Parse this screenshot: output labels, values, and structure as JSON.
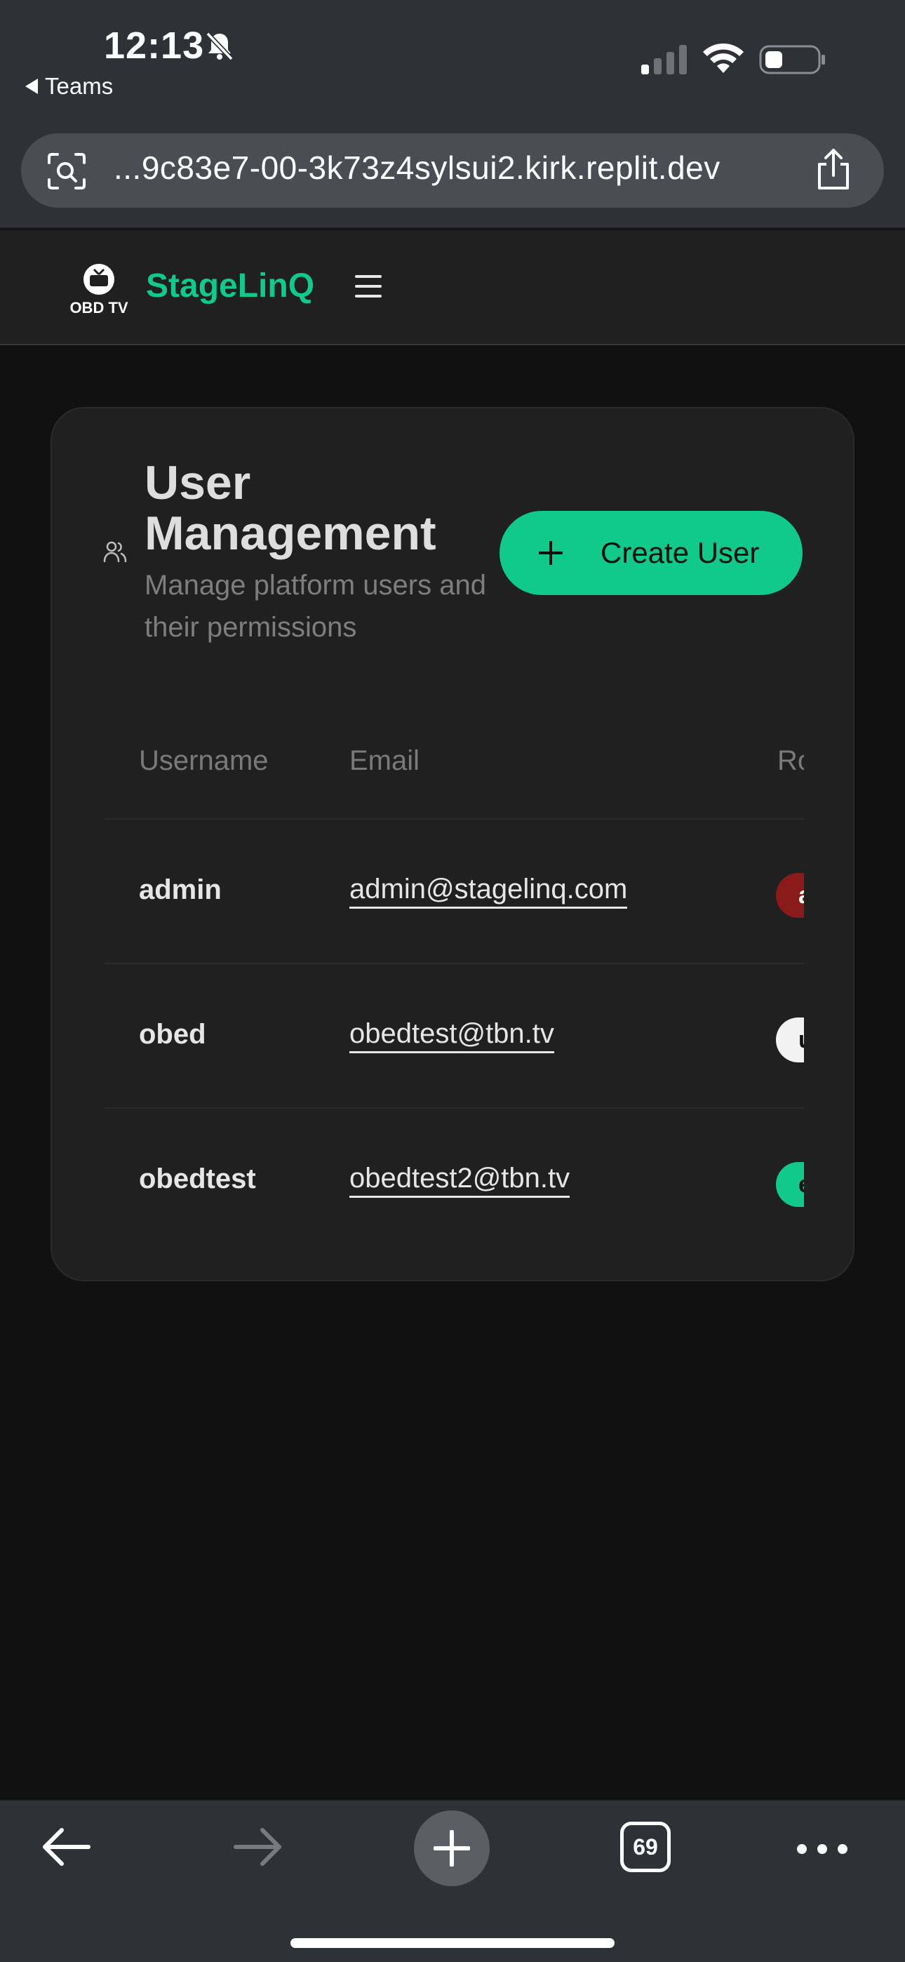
{
  "status_bar": {
    "time": "12:13",
    "back_app": "Teams"
  },
  "browser": {
    "url": "...9c83e7-00-3k73z4sylsui2.kirk.replit.dev",
    "tab_count": "69"
  },
  "app": {
    "brand": "StageLinQ",
    "logo_text": "OBD TV",
    "brand_color": "#10c98a"
  },
  "page": {
    "title": "User Management",
    "subtitle": "Manage platform users and their permissions",
    "create_button": "Create User"
  },
  "table": {
    "headers": [
      "Username",
      "Email",
      "Role"
    ],
    "rows": [
      {
        "username": "admin",
        "email": "admin@stagelinq.com",
        "role": "admin",
        "role_color": "#8b1a1a",
        "role_text_color": "#ffffff"
      },
      {
        "username": "obed",
        "email": "obedtest@tbn.tv",
        "role": "user",
        "role_color": "#f2f2f2",
        "role_text_color": "#111111"
      },
      {
        "username": "obedtest",
        "email": "obedtest2@tbn.tv",
        "role": "engineer",
        "role_color": "#10c98a",
        "role_text_color": "#111111"
      }
    ]
  },
  "icons": {
    "status": [
      "bell-slash-icon",
      "cellular-signal-icon",
      "wifi-icon",
      "battery-icon"
    ],
    "browser": [
      "visual-lookup-icon",
      "share-icon",
      "back-arrow-icon",
      "forward-arrow-icon",
      "new-tab-icon",
      "tabs-icon",
      "more-icon"
    ],
    "app": [
      "obd-tv-logo",
      "hamburger-menu-icon",
      "users-icon",
      "plus-icon"
    ]
  }
}
